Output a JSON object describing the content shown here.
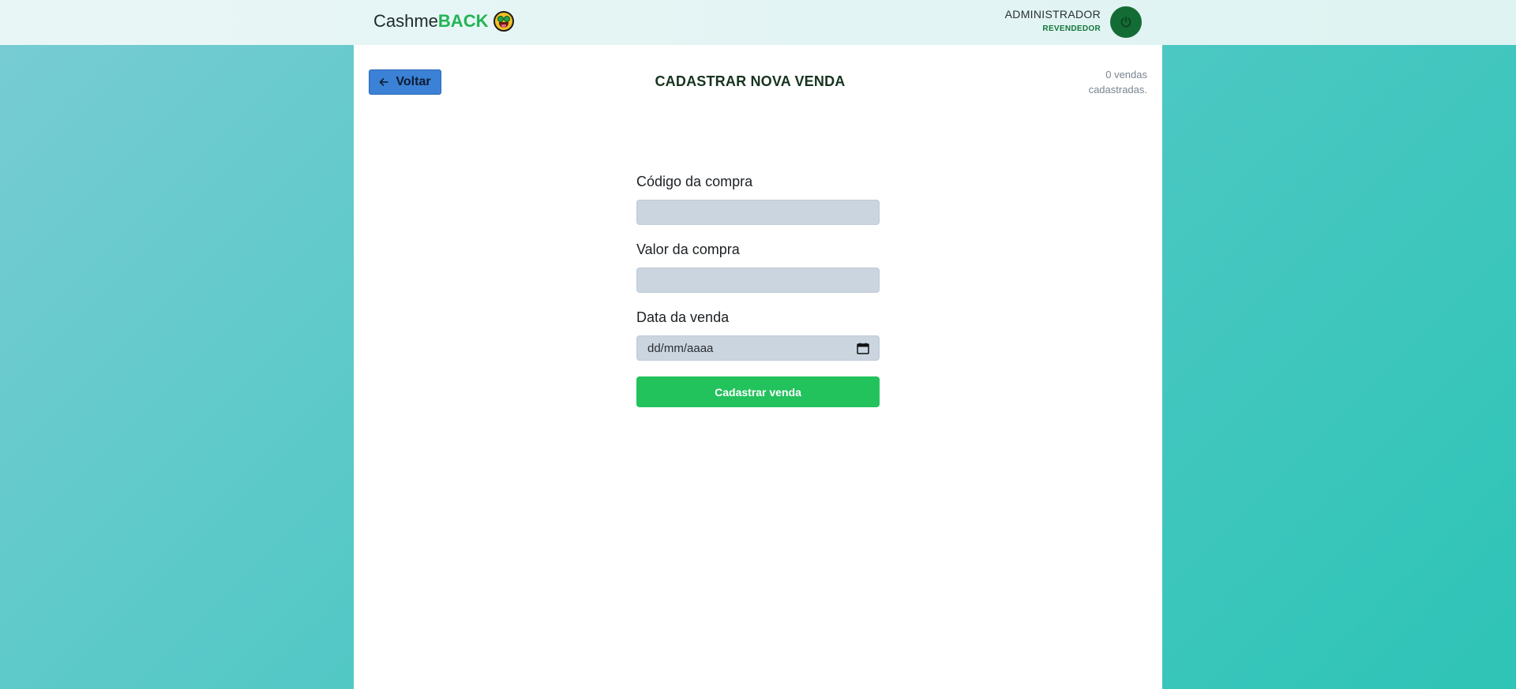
{
  "header": {
    "brand_prefix": "Cashme",
    "brand_accent": "BACK",
    "brand_icon": "money-face-emoji",
    "user_name": "ADMINISTRADOR",
    "user_role": "REVENDEDOR",
    "logout_icon": "power-icon"
  },
  "page": {
    "back_label": "Voltar",
    "back_icon": "arrow-left-icon",
    "title": "CADASTRAR NOVA VENDA",
    "count_line1": "0 vendas",
    "count_line2": "cadastradas."
  },
  "form": {
    "code_label": "Código da compra",
    "code_value": "",
    "value_label": "Valor da compra",
    "value_value": "",
    "date_label": "Data da venda",
    "date_placeholder": "dd/mm/aaaa",
    "date_icon": "calendar-icon",
    "submit_label": "Cadastrar venda"
  },
  "colors": {
    "accent": "#22c25c",
    "back_button": "#3b82d6",
    "logout_button": "#146c35",
    "field_bg": "#cbd5e0"
  }
}
